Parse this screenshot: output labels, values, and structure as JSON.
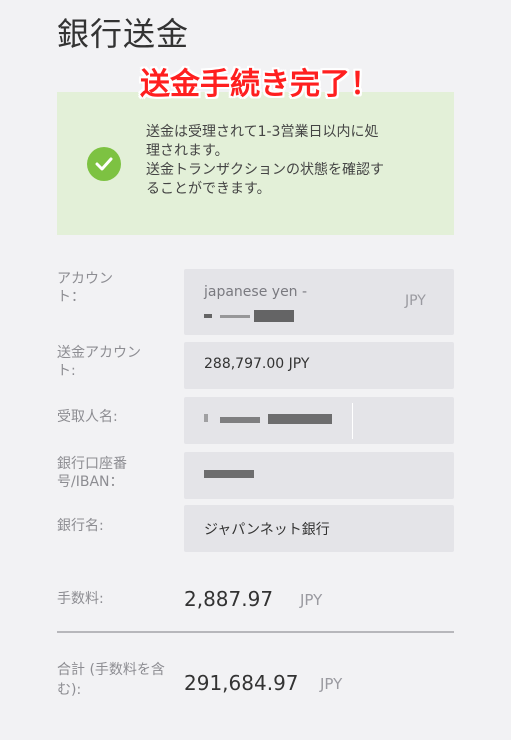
{
  "header": {
    "title": "銀行送金",
    "caption": "送金手続き完了！"
  },
  "alert": {
    "icon": "check-circle-icon",
    "message": "送金は受理されて1-3営業日以内に処\n理されます。\n送金トランザクションの状態を確認す\nることができます。",
    "color": "#7dc242",
    "background": "#e3f0d8"
  },
  "form": {
    "account": {
      "label": "アカウント：",
      "value": "japanese yen -",
      "currency": "JPY"
    },
    "amount": {
      "label": "送金アカウント:",
      "value": "288,797.00 JPY"
    },
    "recipient": {
      "label": "受取人名:"
    },
    "account_number": {
      "label": "銀行口座番号/IBAN："
    },
    "bank": {
      "label": "銀行名:",
      "value": "ジャパンネット銀行"
    }
  },
  "fees": {
    "fee": {
      "label": "手数料:",
      "value": "2,887.97",
      "currency": "JPY"
    },
    "total": {
      "label": "合計 (手数料を含む):",
      "value": "291,684.97",
      "currency": "JPY"
    }
  }
}
